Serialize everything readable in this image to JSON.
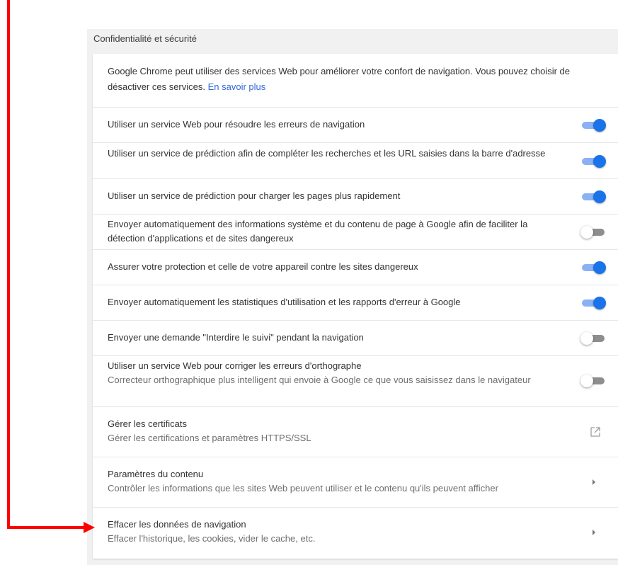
{
  "section": {
    "title": "Confidentialité et sécurité"
  },
  "intro": {
    "text": "Google Chrome peut utiliser des services Web pour améliorer votre confort de navigation. Vous pouvez choisir de désactiver ces services.",
    "link": "En savoir plus"
  },
  "toggles": [
    {
      "label": "Utiliser un service Web pour résoudre les erreurs de navigation",
      "state": "on"
    },
    {
      "label": "Utiliser un service de prédiction afin de compléter les recherches et les URL saisies dans la barre d'adresse",
      "state": "on"
    },
    {
      "label": "Utiliser un service de prédiction pour charger les pages plus rapidement",
      "state": "on"
    },
    {
      "label": "Envoyer automatiquement des informations système et du contenu de page à Google afin de faciliter la détection d'applications et de sites dangereux",
      "state": "off"
    },
    {
      "label": "Assurer votre protection et celle de votre appareil contre les sites dangereux",
      "state": "on"
    },
    {
      "label": "Envoyer automatiquement les statistiques d'utilisation et les rapports d'erreur à Google",
      "state": "on"
    },
    {
      "label": "Envoyer une demande \"Interdire le suivi\" pendant la navigation",
      "state": "off"
    },
    {
      "label": "Utiliser un service Web pour corriger les erreurs d'orthographe",
      "sub": "Correcteur orthographique plus intelligent qui envoie à Google ce que vous saisissez dans le navigateur",
      "state": "off"
    }
  ],
  "links": [
    {
      "label": "Gérer les certificats",
      "sub": "Gérer les certifications et paramètres HTTPS/SSL",
      "icon": "external-link-icon"
    },
    {
      "label": "Paramètres du contenu",
      "sub": "Contrôler les informations que les sites Web peuvent utiliser et le contenu qu'ils peuvent afficher",
      "icon": "arrow-right-icon"
    },
    {
      "label": "Effacer les données de navigation",
      "sub": "Effacer l'historique, les cookies, vider le cache, etc.",
      "icon": "arrow-right-icon"
    }
  ],
  "colors": {
    "toggle_on": "#1a73e8",
    "toggle_on_track": "#8ab0f5",
    "toggle_off_track": "#8e8e8e",
    "link": "#3367d6",
    "annotation": "#ff0000"
  }
}
